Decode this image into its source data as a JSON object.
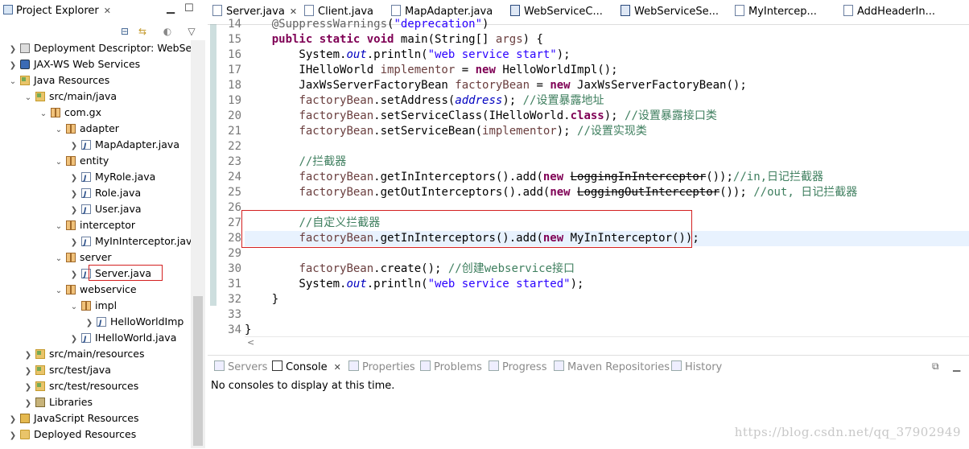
{
  "left_panel": {
    "title": "Project Explorer",
    "tree": [
      {
        "label": "Deployment Descriptor: WebSer",
        "icon": "descriptor-icon",
        "expanded": false
      },
      {
        "label": "JAX-WS Web Services",
        "icon": "webservice-icon",
        "expanded": false
      },
      {
        "label": "Java Resources",
        "icon": "java-resources-icon",
        "expanded": true
      },
      {
        "label": "src/main/java",
        "icon": "source-folder-icon",
        "expanded": true
      },
      {
        "label": "com.gx",
        "icon": "package-icon",
        "expanded": true
      },
      {
        "label": "adapter",
        "icon": "package-icon",
        "expanded": true
      },
      {
        "label": "MapAdapter.java",
        "icon": "java-file-icon",
        "expanded": false
      },
      {
        "label": "entity",
        "icon": "package-icon",
        "expanded": true
      },
      {
        "label": "MyRole.java",
        "icon": "java-file-icon",
        "expanded": false
      },
      {
        "label": "Role.java",
        "icon": "java-file-icon",
        "expanded": false
      },
      {
        "label": "User.java",
        "icon": "java-file-icon",
        "expanded": false
      },
      {
        "label": "interceptor",
        "icon": "package-icon",
        "expanded": true
      },
      {
        "label": "MyInInterceptor.jav",
        "icon": "java-file-icon",
        "expanded": false
      },
      {
        "label": "server",
        "icon": "package-icon",
        "expanded": true
      },
      {
        "label": "Server.java",
        "icon": "java-file-icon",
        "expanded": false
      },
      {
        "label": "webservice",
        "icon": "package-icon",
        "expanded": true
      },
      {
        "label": "impl",
        "icon": "package-icon",
        "expanded": true
      },
      {
        "label": "HelloWorldImp",
        "icon": "java-file-icon",
        "expanded": false
      },
      {
        "label": "IHelloWorld.java",
        "icon": "java-file-icon",
        "expanded": false
      },
      {
        "label": "src/main/resources",
        "icon": "source-folder-icon",
        "expanded": false
      },
      {
        "label": "src/test/java",
        "icon": "source-folder-icon",
        "expanded": false
      },
      {
        "label": "src/test/resources",
        "icon": "source-folder-icon",
        "expanded": false
      },
      {
        "label": "Libraries",
        "icon": "library-icon",
        "expanded": false
      },
      {
        "label": "JavaScript Resources",
        "icon": "javascript-icon",
        "expanded": false
      },
      {
        "label": "Deployed Resources",
        "icon": "folder-icon",
        "expanded": false
      }
    ]
  },
  "editor": {
    "tabs": [
      {
        "label": "Server.java",
        "active": true
      },
      {
        "label": "Client.java",
        "active": false
      },
      {
        "label": "MapAdapter.java",
        "active": false
      },
      {
        "label": "WebServiceC...",
        "active": false
      },
      {
        "label": "WebServiceSe...",
        "active": false
      },
      {
        "label": "MyIntercep...",
        "active": false
      },
      {
        "label": "AddHeaderIn...",
        "active": false
      }
    ],
    "line_numbers": [
      "14",
      "15",
      "16",
      "17",
      "18",
      "19",
      "20",
      "21",
      "22",
      "23",
      "24",
      "25",
      "26",
      "27",
      "28",
      "29",
      "30",
      "31",
      "32",
      "33",
      "34"
    ],
    "code_lines": [
      "    @SuppressWarnings(\"deprecation\")",
      "    public static void main(String[] args) {",
      "        System.out.println(\"web service start\");",
      "        IHelloWorld implementor = new HelloWorldImpl();",
      "        JaxWsServerFactoryBean factoryBean = new JaxWsServerFactoryBean();",
      "        factoryBean.setAddress(address); //设置暴露地址",
      "        factoryBean.setServiceClass(IHelloWorld.class); //设置暴露接口类",
      "        factoryBean.setServiceBean(implementor); //设置实现类",
      "",
      "        //拦截器",
      "        factoryBean.getInInterceptors().add(new LoggingInInterceptor());//in,日记拦截器",
      "        factoryBean.getOutInterceptors().add(new LoggingOutInterceptor()); //out, 日记拦截器",
      "",
      "        //自定义拦截器",
      "        factoryBean.getInInterceptors().add(new MyInInterceptor());",
      "",
      "        factoryBean.create(); //创建webservice接口",
      "        System.out.println(\"web service started\");",
      "    }",
      "",
      "}"
    ]
  },
  "bottom_panel": {
    "tabs": [
      {
        "label": "Servers",
        "active": false
      },
      {
        "label": "Console",
        "active": true
      },
      {
        "label": "Properties",
        "active": false
      },
      {
        "label": "Problems",
        "active": false
      },
      {
        "label": "Progress",
        "active": false
      },
      {
        "label": "Maven Repositories",
        "active": false
      },
      {
        "label": "History",
        "active": false
      }
    ],
    "console_message": "No consoles to display at this time.",
    "watermark": "https://blog.csdn.net/qq_37902949"
  },
  "colors": {
    "keyword": "#7f0055",
    "string": "#2a00ff",
    "comment": "#3f7f5f",
    "highlight_box": "#d32020"
  }
}
